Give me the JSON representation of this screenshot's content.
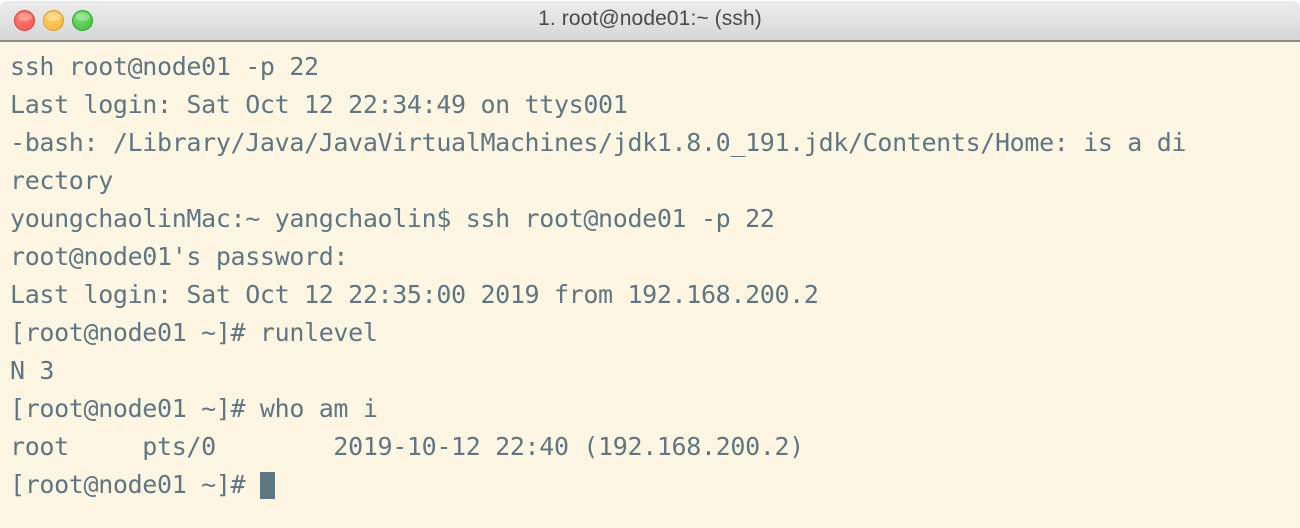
{
  "window": {
    "title": "1. root@node01:~ (ssh)",
    "controls": [
      {
        "name": "close",
        "label": "Close",
        "color": "#f4574c"
      },
      {
        "name": "minimize",
        "label": "Minimize",
        "color": "#f7b52c"
      },
      {
        "name": "zoom",
        "label": "Zoom",
        "color": "#3fc03c"
      }
    ],
    "background_color": "#fdf6e3",
    "foreground_color": "#5f7683",
    "titlebar_color": "#e4e4e4"
  },
  "terminal": {
    "lines": [
      "ssh root@node01 -p 22",
      "Last login: Sat Oct 12 22:34:49 on ttys001",
      "-bash: /Library/Java/JavaVirtualMachines/jdk1.8.0_191.jdk/Contents/Home: is a di",
      "rectory",
      "youngchaolinMac:~ yangchaolin$ ssh root@node01 -p 22",
      "root@node01's password:",
      "Last login: Sat Oct 12 22:35:00 2019 from 192.168.200.2",
      "[root@node01 ~]# runlevel",
      "N 3",
      "[root@node01 ~]# who am i",
      "root     pts/0        2019-10-12 22:40 (192.168.200.2)"
    ],
    "prompt": "[root@node01 ~]# ",
    "cursor": "block"
  }
}
